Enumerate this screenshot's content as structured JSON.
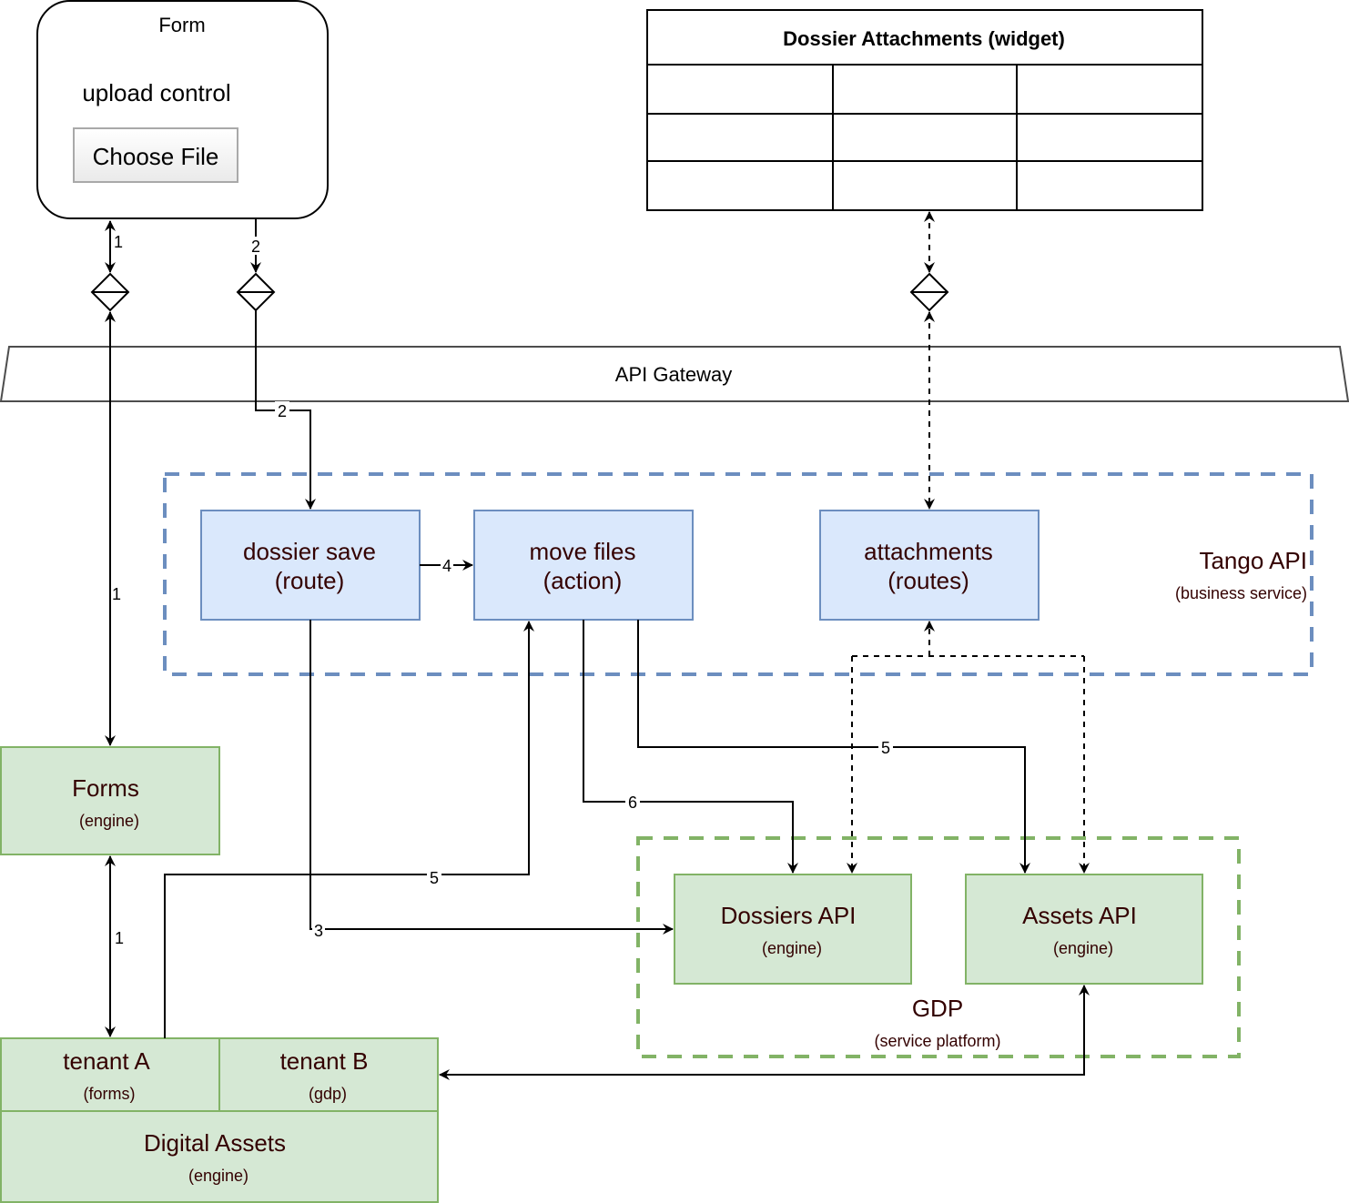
{
  "form": {
    "title": "Form",
    "upload_label": "upload control",
    "choose_file_button": "Choose File"
  },
  "widget": {
    "title": "Dossier Attachments (widget)",
    "rows": 3,
    "cols": 3
  },
  "gateway": {
    "label": "API Gateway"
  },
  "tango": {
    "title": "Tango API",
    "subtitle": "(business service)",
    "dossier_save": {
      "line1": "dossier save",
      "line2": "(route)"
    },
    "move_files": {
      "line1": "move files",
      "line2": "(action)"
    },
    "attachments": {
      "line1": "attachments",
      "line2": "(routes)"
    }
  },
  "forms_engine": {
    "title": "Forms",
    "subtitle": "(engine)"
  },
  "gdp": {
    "title": "GDP",
    "subtitle": "(service platform)",
    "dossiers_api": {
      "title": "Dossiers API",
      "subtitle": "(engine)"
    },
    "assets_api": {
      "title": "Assets API",
      "subtitle": "(engine)"
    }
  },
  "digital_assets": {
    "title": "Digital Assets",
    "subtitle": "(engine)",
    "tenant_a": {
      "title": "tenant A",
      "subtitle": "(forms)"
    },
    "tenant_b": {
      "title": "tenant B",
      "subtitle": "(gdp)"
    }
  },
  "edges": {
    "form_to_forms_upper": "1",
    "form_to_forms_mid": "1",
    "forms_to_tenant_a": "1",
    "form_to_gateway": "2",
    "gateway_to_dossier_save": "2",
    "dossier_save_to_dossiers_api": "3",
    "dossier_save_to_move_files": "4",
    "tenant_a_to_move_files": "5",
    "move_files_to_assets_api": "5",
    "move_files_to_dossiers_api": "6"
  },
  "colors": {
    "tango_fill": "#dae8fc",
    "tango_stroke": "#6c8ebf",
    "engine_fill": "#d5e8d4",
    "engine_stroke": "#82b366",
    "text_dark": "#330000"
  }
}
